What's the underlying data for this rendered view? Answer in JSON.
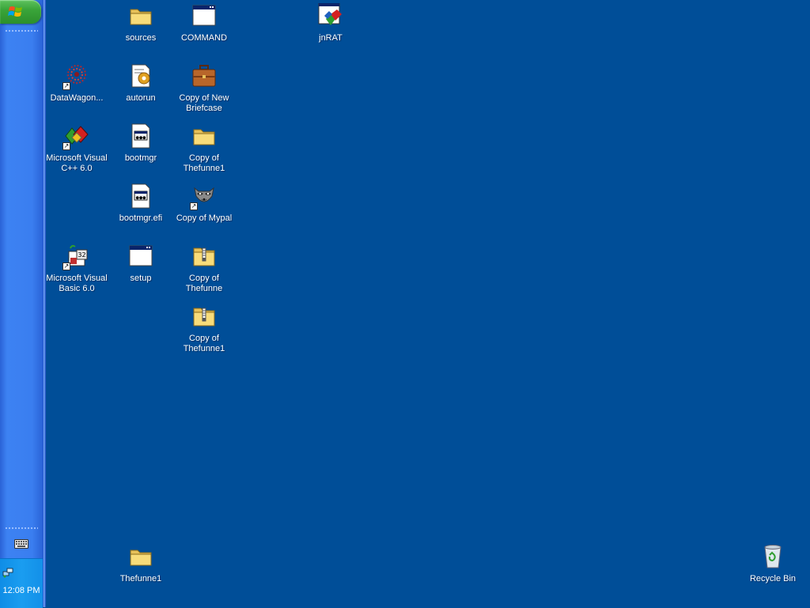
{
  "taskbar": {
    "clock": "12:08 PM"
  },
  "desktop": {
    "icons": {
      "sources": "sources",
      "command": "COMMAND",
      "jnrat": "jnRAT",
      "datawagon": "DataWagon...",
      "autorun": "autorun",
      "copy_new_briefcase": "Copy of New Briefcase",
      "msvc": "Microsoft Visual C++ 6.0",
      "bootmgr": "bootmgr",
      "copy_thefunne1_folder": "Copy of Thefunne1",
      "bootmgr_efi": "bootmgr.efi",
      "copy_mypal": "Copy of Mypal",
      "msvb": "Microsoft Visual Basic 6.0",
      "setup": "setup",
      "copy_thefunne_zip": "Copy of Thefunne",
      "copy_thefunne1_zip": "Copy of Thefunne1",
      "thefunne1": "Thefunne1",
      "recycle_bin": "Recycle Bin"
    }
  },
  "colors": {
    "desktop_background": "#004e98",
    "taskbar_blue": "#3a7ef0",
    "start_green": "#3aa53a",
    "tray_blue": "#1a9df0"
  }
}
